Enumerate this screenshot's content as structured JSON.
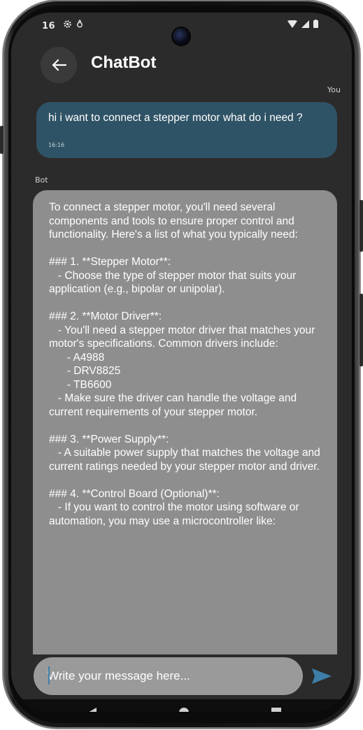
{
  "status_bar": {
    "time": "16",
    "left_icons": [
      "gear-icon",
      "vpn-icon"
    ],
    "right_icons": [
      "wifi-icon",
      "signal-icon",
      "battery-icon"
    ]
  },
  "app_bar": {
    "title": "ChatBot",
    "back_icon": "arrow-left-icon"
  },
  "messages": [
    {
      "sender_label": "You",
      "text": "hi i want to connect a stepper motor what do i need ?",
      "time": "16:16",
      "color": "#2f5366"
    },
    {
      "sender_label": "Bot",
      "text": "To connect a stepper motor, you'll need several components and tools to ensure proper control and functionality. Here's a list of what you typically need:\n\n### 1. **Stepper Motor**:\n   - Choose the type of stepper motor that suits your application (e.g., bipolar or unipolar).\n\n### 2. **Motor Driver**:\n   - You'll need a stepper motor driver that matches your motor's specifications. Common drivers include:\n      - A4988\n      - DRV8825\n      - TB6600\n   - Make sure the driver can handle the voltage and current requirements of your stepper motor.\n\n### 3. **Power Supply**:\n   - A suitable power supply that matches the voltage and current ratings needed by your stepper motor and driver.\n\n### 4. **Control Board (Optional)**:\n   - If you want to control the motor using software or automation, you may use a microcontroller like:",
      "color": "#8e8e8e"
    }
  ],
  "composer": {
    "placeholder": "Write your message here...",
    "value": "",
    "send_icon": "send-icon",
    "accent": "#3d7fa8"
  },
  "nav_bar": {
    "icons": [
      "nav-back-icon",
      "nav-home-icon",
      "nav-recents-icon"
    ]
  }
}
